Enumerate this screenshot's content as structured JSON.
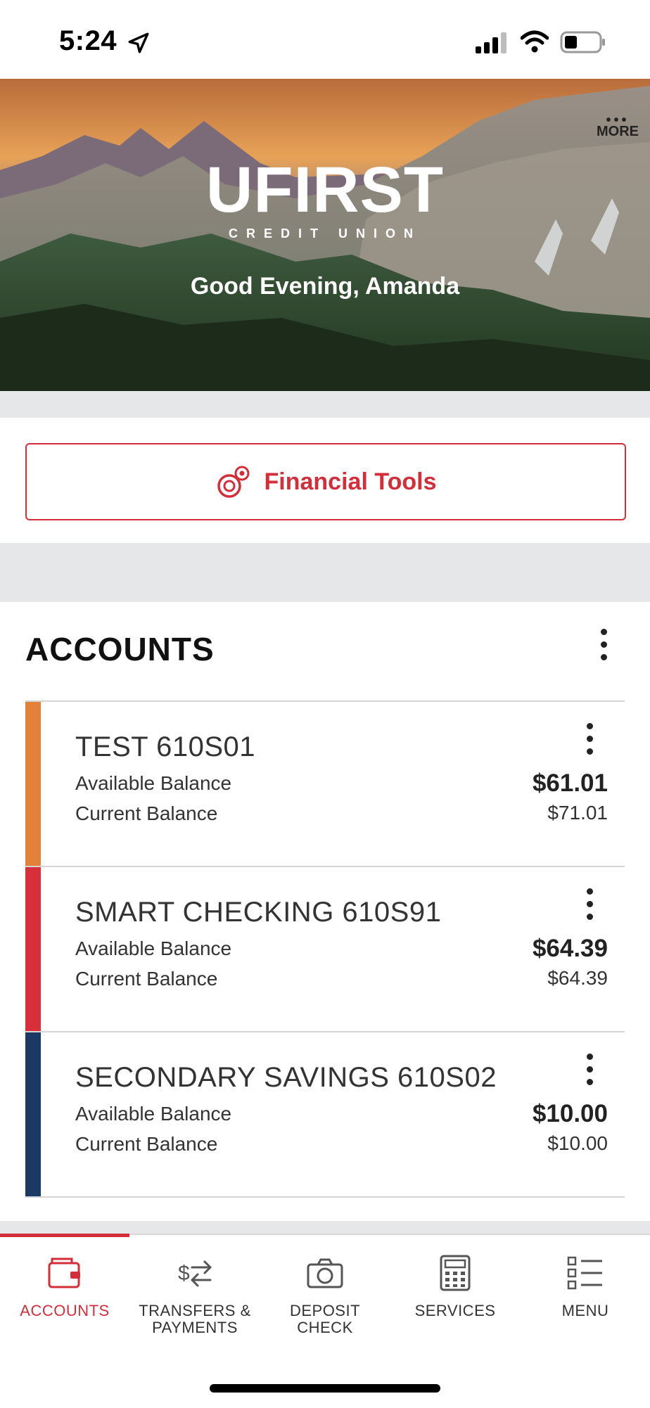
{
  "status_bar": {
    "time": "5:24",
    "icons": [
      "location-arrow-icon",
      "signal-icon",
      "wifi-icon",
      "battery-icon"
    ]
  },
  "hero": {
    "logo_text": "UFIRST",
    "logo_subtext": "CREDIT UNION",
    "greeting": "Good Evening, Amanda",
    "more_label": "MORE"
  },
  "financial_tools": {
    "label": "Financial Tools",
    "icon": "coins-icon"
  },
  "accounts": {
    "title": "ACCOUNTS",
    "items": [
      {
        "name": "TEST 610S01",
        "available_label": "Available Balance",
        "current_label": "Current Balance",
        "available": "$61.01",
        "current": "$71.01",
        "color": "#e2813a"
      },
      {
        "name": "SMART CHECKING 610S91",
        "available_label": "Available Balance",
        "current_label": "Current Balance",
        "available": "$64.39",
        "current": "$64.39",
        "color": "#d8303b"
      },
      {
        "name": "SECONDARY SAVINGS 610S02",
        "available_label": "Available Balance",
        "current_label": "Current Balance",
        "available": "$10.00",
        "current": "$10.00",
        "color": "#1b3a63"
      }
    ]
  },
  "bottom_nav": {
    "items": [
      {
        "label": "ACCOUNTS",
        "icon": "wallet-icon",
        "active": true
      },
      {
        "label": "TRANSFERS & PAYMENTS",
        "icon": "transfer-icon",
        "active": false
      },
      {
        "label": "DEPOSIT CHECK",
        "icon": "camera-icon",
        "active": false
      },
      {
        "label": "SERVICES",
        "icon": "calculator-icon",
        "active": false
      },
      {
        "label": "MENU",
        "icon": "menu-list-icon",
        "active": false
      }
    ]
  },
  "colors": {
    "brand_red": "#d32f3a",
    "accounts_bar_orange": "#e2813a",
    "accounts_bar_red": "#d8303b",
    "accounts_bar_navy": "#1b3a63"
  }
}
